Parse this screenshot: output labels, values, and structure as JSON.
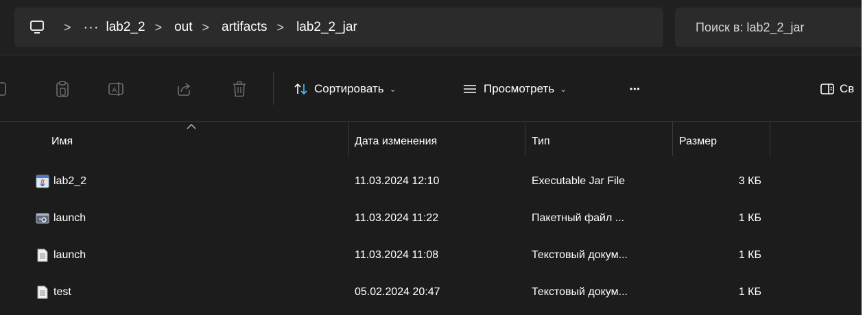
{
  "address": {
    "overflow": "···",
    "crumbs": [
      "lab2_2",
      "out",
      "artifacts",
      "lab2_2_jar"
    ],
    "separator": ">"
  },
  "search": {
    "placeholder": "Поиск в: lab2_2_jar"
  },
  "toolbar": {
    "sort_label": "Сортировать",
    "view_label": "Просмотреть",
    "more_label": "•••",
    "details_label": "Св"
  },
  "columns": {
    "name": "Имя",
    "date": "Дата изменения",
    "type": "Тип",
    "size": "Размер"
  },
  "files": [
    {
      "name": "lab2_2",
      "date": "11.03.2024 12:10",
      "type": "Executable Jar File",
      "size": "3 КБ",
      "icon": "jar-file-icon"
    },
    {
      "name": "launch",
      "date": "11.03.2024 11:22",
      "type": "Пакетный файл ...",
      "size": "1 КБ",
      "icon": "batch-file-icon"
    },
    {
      "name": "launch",
      "date": "11.03.2024 11:08",
      "type": "Текстовый докум...",
      "size": "1 КБ",
      "icon": "text-file-icon"
    },
    {
      "name": "test",
      "date": "05.02.2024 20:47",
      "type": "Текстовый докум...",
      "size": "1 КБ",
      "icon": "text-file-icon"
    }
  ],
  "colors": {
    "background": "#1c1c1c",
    "address_bar": "#2b2b2b",
    "text": "#ffffff"
  }
}
